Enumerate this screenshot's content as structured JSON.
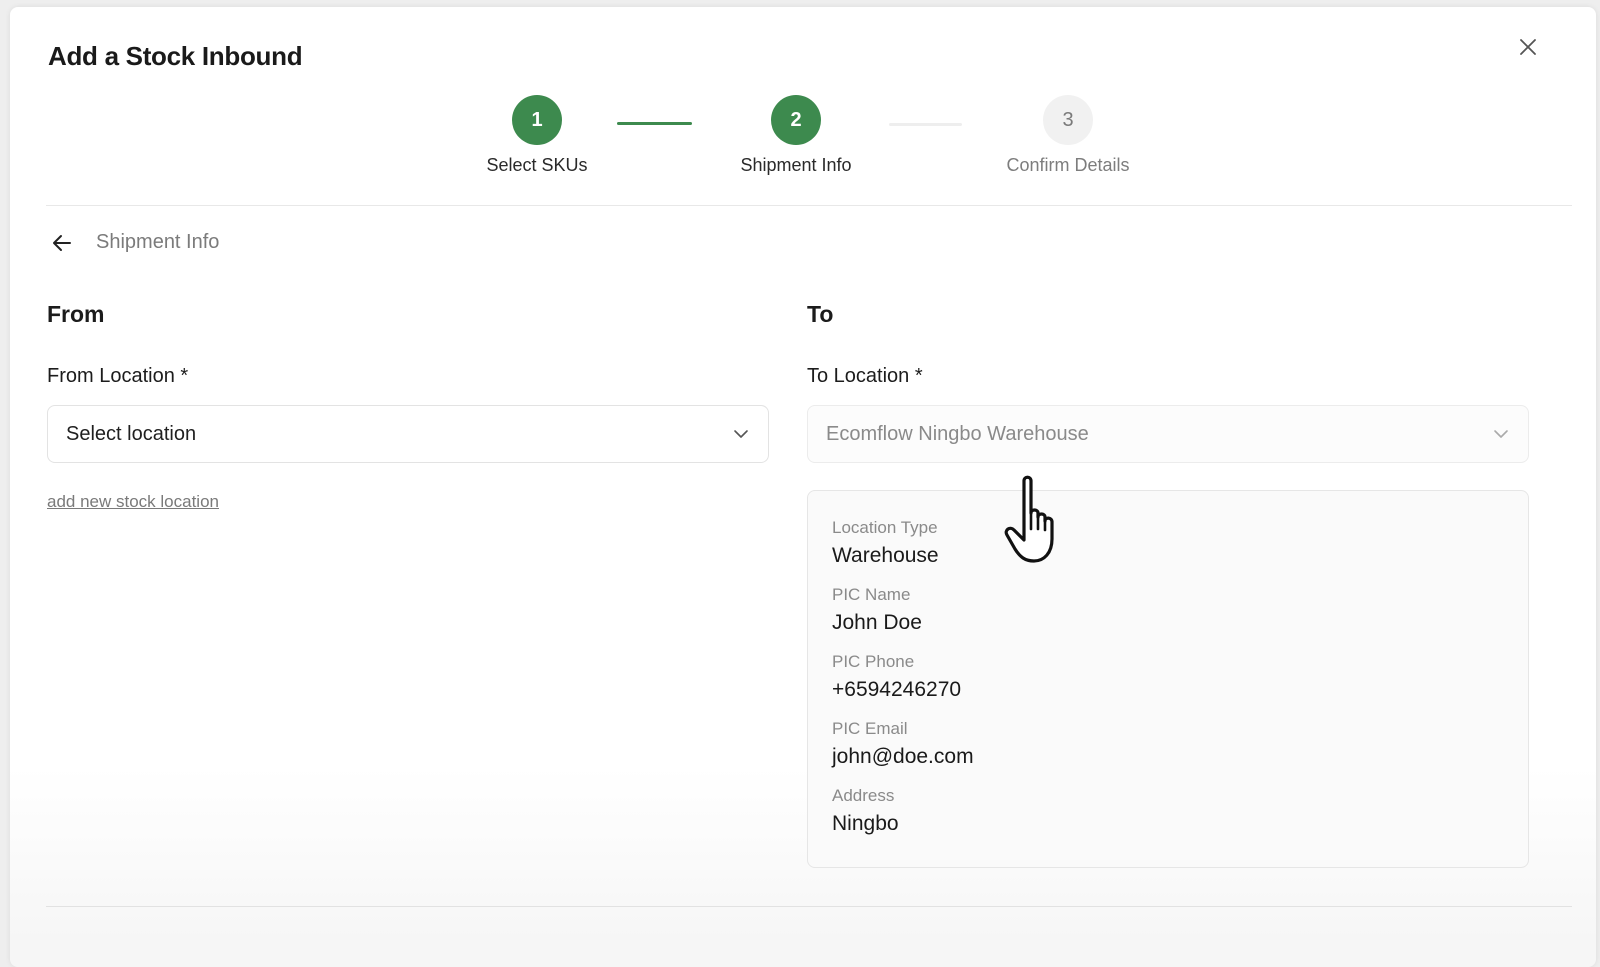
{
  "modal": {
    "title": "Add a Stock Inbound",
    "close_icon": "close-icon"
  },
  "stepper": {
    "steps": [
      {
        "number": "1",
        "label": "Select SKUs",
        "state": "completed"
      },
      {
        "number": "2",
        "label": "Shipment Info",
        "state": "current"
      },
      {
        "number": "3",
        "label": "Confirm Details",
        "state": "pending"
      }
    ],
    "active_color": "#3d8a4e"
  },
  "section": {
    "back_icon": "arrow-left-icon",
    "title": "Shipment Info"
  },
  "from": {
    "heading": "From",
    "location_label": "From Location *",
    "location_placeholder": "Select location",
    "add_link": "add new stock location"
  },
  "to": {
    "heading": "To",
    "location_label": "To Location *",
    "location_value": "Ecomflow Ningbo Warehouse",
    "details": {
      "location_type_label": "Location Type",
      "location_type": "Warehouse",
      "pic_name_label": "PIC Name",
      "pic_name": "John Doe",
      "pic_phone_label": "PIC Phone",
      "pic_phone": "+6594246270",
      "pic_email_label": "PIC Email",
      "pic_email": "john@doe.com",
      "address_label": "Address",
      "address": "Ningbo"
    }
  },
  "cursor": "hand-pointer-icon"
}
